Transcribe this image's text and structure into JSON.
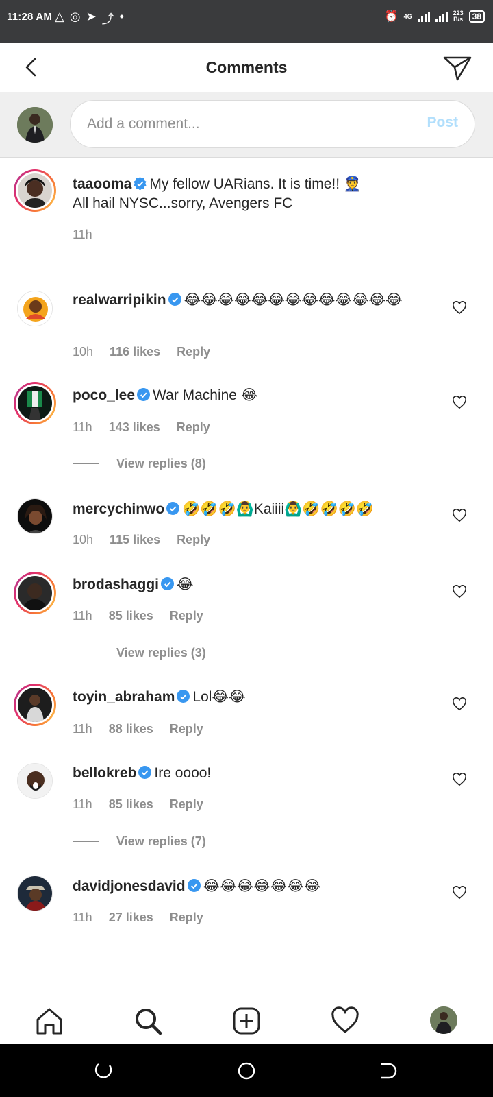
{
  "status_bar": {
    "time": "11:28 AM",
    "network_label": "4G",
    "speed_value": "223",
    "speed_unit": "B/s",
    "battery": "38"
  },
  "header": {
    "title": "Comments"
  },
  "composer": {
    "placeholder": "Add a comment...",
    "post_label": "Post"
  },
  "caption": {
    "username": "taaooma",
    "text_line1": "My fellow UARians. It is time!! 👮",
    "text_line2": "All hail NYSC...sorry, Avengers FC",
    "time": "11h"
  },
  "comments": [
    {
      "username": "realwarripikin",
      "text": "😂😂😂😂😂😂😂😂😂😂😂😂😂",
      "time": "10h",
      "likes": "116 likes",
      "reply": "Reply"
    },
    {
      "username": "poco_lee",
      "text": "War Machine 😂",
      "time": "11h",
      "likes": "143 likes",
      "reply": "Reply",
      "view_replies": "View replies (8)"
    },
    {
      "username": "mercychinwo",
      "text": "🤣🤣🤣🙆‍♂️Kaiiii🙆‍♂️🤣🤣🤣🤣",
      "time": "10h",
      "likes": "115 likes",
      "reply": "Reply"
    },
    {
      "username": "brodashaggi",
      "text": "😂",
      "time": "11h",
      "likes": "85 likes",
      "reply": "Reply",
      "view_replies": "View replies (3)"
    },
    {
      "username": "toyin_abraham",
      "text": "Lol😂😂",
      "time": "11h",
      "likes": "88 likes",
      "reply": "Reply"
    },
    {
      "username": "bellokreb",
      "text": "Ire oooo!",
      "time": "11h",
      "likes": "85 likes",
      "reply": "Reply",
      "view_replies": "View replies (7)"
    },
    {
      "username": "davidjonesdavid",
      "text": "😂😂😂😂😂😂😂",
      "time": "11h",
      "likes": "27 likes",
      "reply": "Reply"
    }
  ],
  "colors": {
    "verified": "#3897f0",
    "muted": "#8e8e8e",
    "post_disabled": "#b2dffc"
  }
}
